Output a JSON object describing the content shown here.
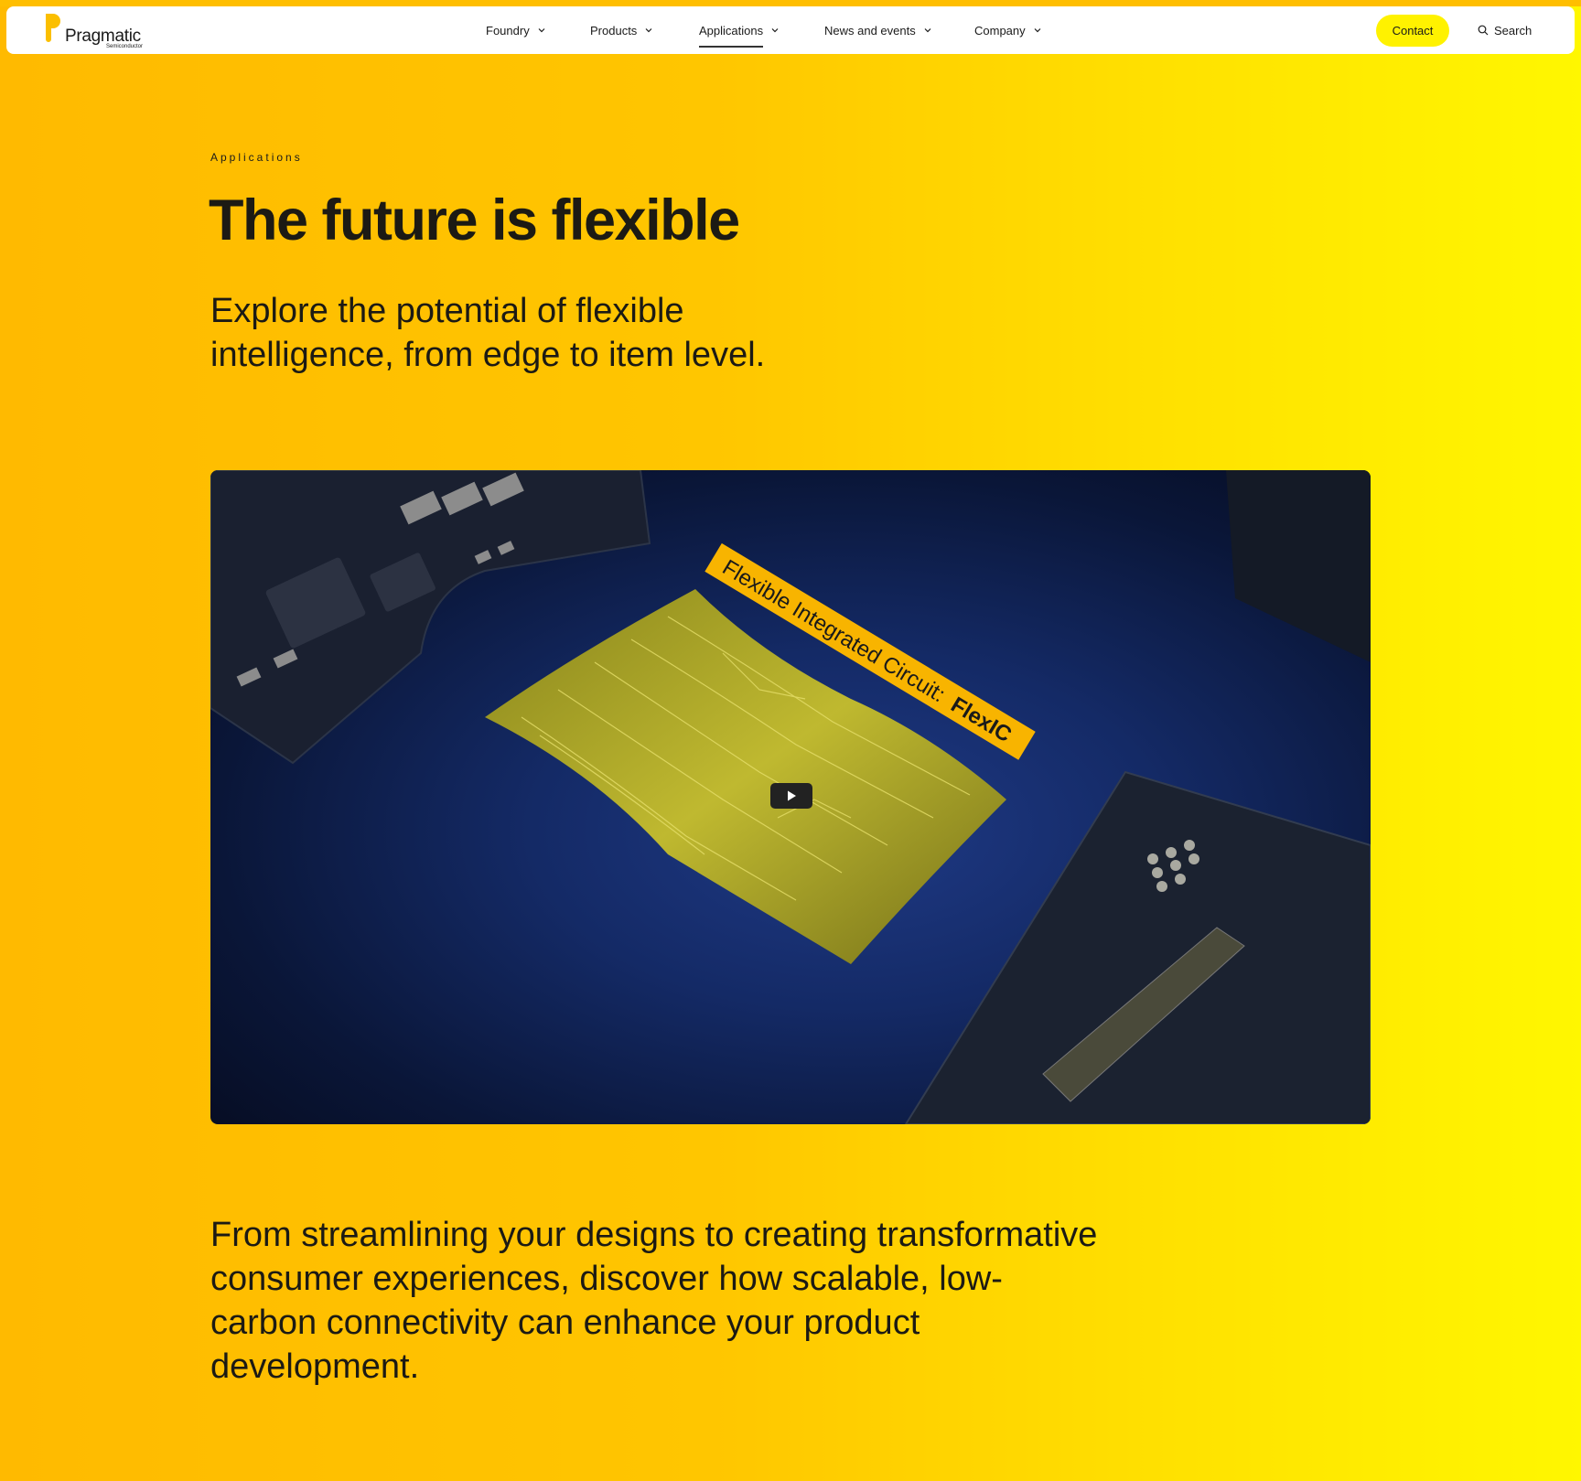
{
  "brand": {
    "name": "Pragmatic",
    "tagline": "Semiconductor",
    "color": "#fbbf00"
  },
  "nav": {
    "items": [
      {
        "label": "Foundry",
        "icon": "chevron-down-icon"
      },
      {
        "label": "Products",
        "icon": "chevron-down-icon"
      },
      {
        "label": "Applications",
        "icon": "chevron-down-icon",
        "active": true
      },
      {
        "label": "News and events",
        "icon": "chevron-down-icon"
      },
      {
        "label": "Company",
        "icon": "chevron-down-icon"
      }
    ],
    "contact_label": "Contact",
    "search_label": "Search",
    "search_icon": "search-icon"
  },
  "hero": {
    "eyebrow": "Applications",
    "title": "The future is flexible",
    "subtitle": "Explore the potential of flexible intelligence, from edge to item level."
  },
  "video": {
    "label_prefix": "Flexible Integrated Circuit:",
    "label_strong": "FlexIC",
    "play_icon": "play-icon"
  },
  "body": {
    "paragraph": "From streamlining your designs to creating transformative consumer experiences, discover how scalable, low-carbon connectivity can enhance your product development."
  },
  "colors": {
    "accent": "#fff200",
    "gradient_start": "#ffba00",
    "gradient_end": "#fff700",
    "text": "#1c1a14"
  }
}
